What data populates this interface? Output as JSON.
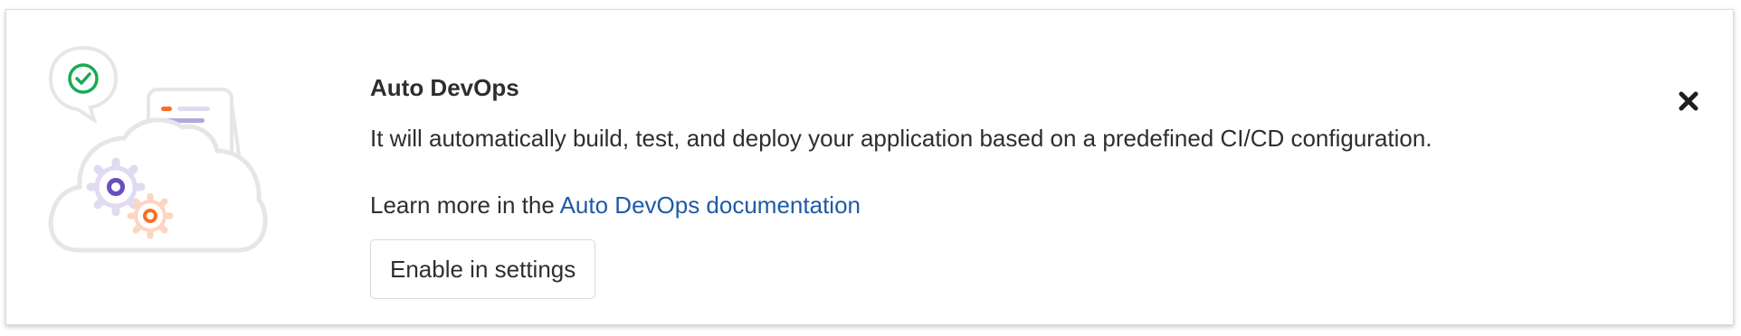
{
  "banner": {
    "title": "Auto DevOps",
    "description": "It will automatically build, test, and deploy your application based on a predefined CI/CD configuration.",
    "learn_more_prefix": "Learn more in the ",
    "learn_more_link": "Auto DevOps documentation",
    "button_label": "Enable in settings",
    "close_icon": "close-icon",
    "illustration_icons": [
      "check-circle-icon",
      "document-icon",
      "cloud-icon",
      "gear-icon"
    ]
  },
  "colors": {
    "link": "#1f5aa6",
    "check_green": "#1aaa55",
    "gear_purple": "#6b4fbb",
    "gear_orange": "#fc6d26",
    "text": "#2e2e2e"
  }
}
